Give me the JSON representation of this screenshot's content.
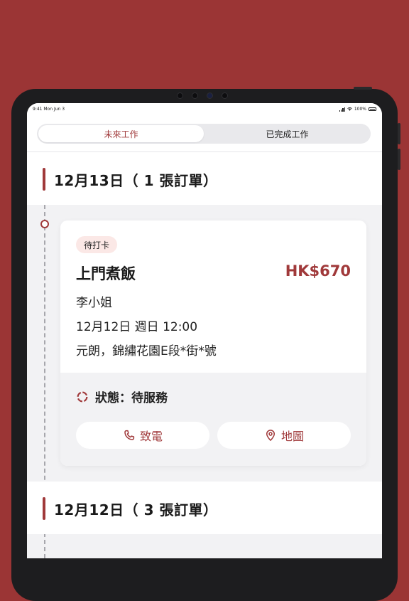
{
  "status_bar": {
    "time": "9:41  Mon Jun 3",
    "battery": "100%"
  },
  "tabs": [
    {
      "label": "未來工作",
      "active": true
    },
    {
      "label": "已完成工作",
      "active": false
    }
  ],
  "groups": [
    {
      "date_label": "12月13日（ 1 張訂單）",
      "orders": [
        {
          "badge": "待打卡",
          "service": "上門煮飯",
          "price": "HK$670",
          "customer": "李小姐",
          "datetime": "12月12日 週日 12:00",
          "address": "元朗，錦繡花園E段*街*號",
          "status_label": "狀態：待服務",
          "actions": {
            "call": "致電",
            "map": "地圖"
          }
        }
      ]
    },
    {
      "date_label": "12月12日（ 3 張訂單）"
    }
  ],
  "colors": {
    "accent": "#a0393a",
    "background": "#9b3535",
    "badge_bg": "#fbe8e6"
  },
  "icons": {
    "call": "phone-icon",
    "map": "location-pin-icon",
    "status": "pending-status-icon"
  }
}
